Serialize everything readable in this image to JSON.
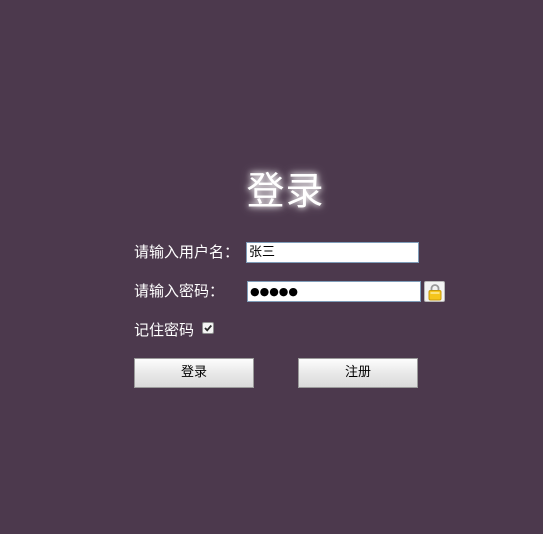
{
  "title": "登录",
  "username": {
    "label": "请输入用户名：",
    "value": "张三"
  },
  "password": {
    "label": "请输入密码：",
    "value": "●●●●●",
    "toggle_icon": "lock-icon"
  },
  "remember": {
    "label": "记住密码",
    "checked": true
  },
  "buttons": {
    "login_label": "登录",
    "register_label": "注册"
  },
  "colors": {
    "background": "#4c394d",
    "text": "#ffffff",
    "lock": "#f5c51b"
  }
}
